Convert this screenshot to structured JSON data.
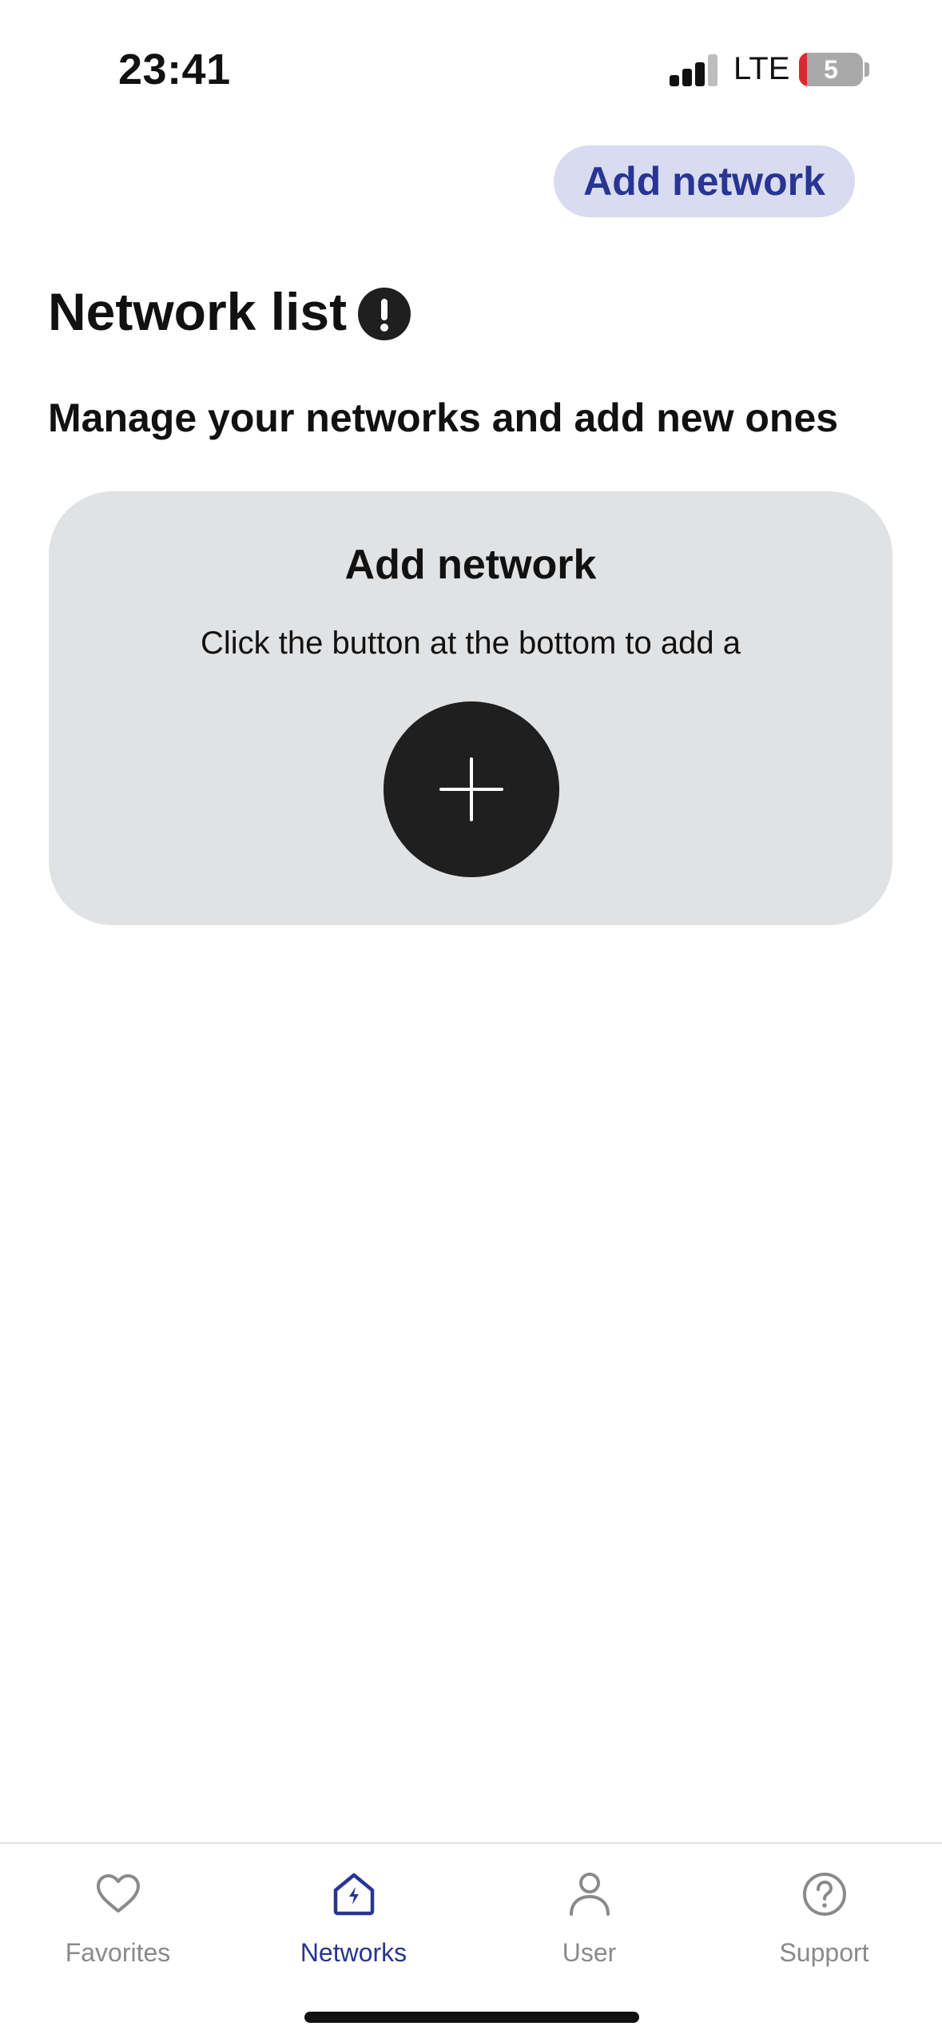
{
  "status_bar": {
    "time": "23:41",
    "network_type": "LTE",
    "battery_level": "5"
  },
  "header": {
    "add_network_label": "Add network"
  },
  "page": {
    "title": "Network list",
    "subtitle": "Manage your networks and add new ones"
  },
  "card": {
    "title": "Add network",
    "text": "Click the button at the bottom to add a"
  },
  "tabs": [
    {
      "label": "Favorites",
      "icon": "heart-icon",
      "active": false
    },
    {
      "label": "Networks",
      "icon": "home-bolt-icon",
      "active": true
    },
    {
      "label": "User",
      "icon": "user-icon",
      "active": false
    },
    {
      "label": "Support",
      "icon": "question-icon",
      "active": false
    }
  ],
  "colors": {
    "accent": "#283593",
    "accent_bg": "#d9dcf0",
    "card_bg": "#e1e2e4",
    "dark": "#1f1f1f",
    "inactive": "#8a8a8a",
    "battery_low": "#e0262f"
  }
}
